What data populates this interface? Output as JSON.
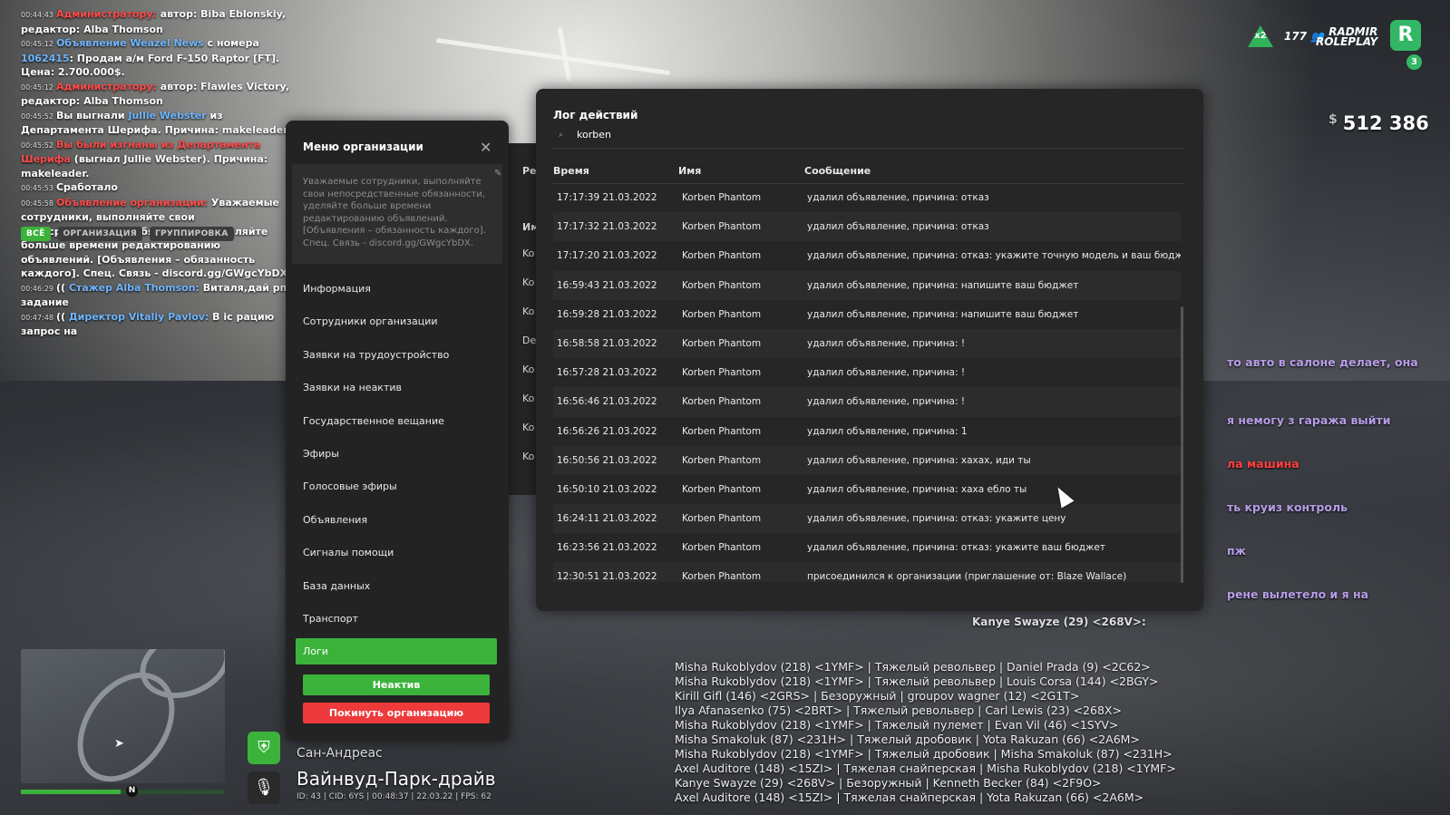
{
  "chat": {
    "lines": [
      {
        "ts": "00:44:43",
        "parts": [
          {
            "t": "Администратору: ",
            "c": "red"
          },
          {
            "t": "автор: Biba Eblonskiy, редактор: Alba Thomson",
            "c": ""
          }
        ]
      },
      {
        "ts": "00:45:12",
        "parts": [
          {
            "t": "Объявление Weazel News",
            "c": "blue"
          },
          {
            "t": " с номера ",
            "c": ""
          },
          {
            "t": "1062415",
            "c": "blue"
          },
          {
            "t": ": Продам а/м Ford F-150 Raptor [FT]. Цена: 2.700.000$.",
            "c": ""
          }
        ]
      },
      {
        "ts": "00:45:12",
        "parts": [
          {
            "t": "Администратору: ",
            "c": "red"
          },
          {
            "t": "автор: Flawles Victory, редактор: Alba Thomson",
            "c": ""
          }
        ]
      },
      {
        "ts": "00:45:52",
        "parts": [
          {
            "t": "Вы выгнали ",
            "c": ""
          },
          {
            "t": "Jullie Webster",
            "c": "blue"
          },
          {
            "t": " из Департамента Шерифа. Причина: makeleader.",
            "c": ""
          }
        ]
      },
      {
        "ts": "00:45:52",
        "parts": [
          {
            "t": "Вы были изгнаны из Департамента Шерифа",
            "c": "red"
          },
          {
            "t": " (выгнал Jullie Webster). Причина: makeleader.",
            "c": ""
          }
        ]
      },
      {
        "ts": "00:45:53",
        "parts": [
          {
            "t": "Сработало",
            "c": ""
          }
        ]
      },
      {
        "ts": "00:45:58",
        "parts": [
          {
            "t": "Объявление организации: ",
            "c": "red"
          },
          {
            "t": "Уважаемые сотрудники, выполняйте свои непосредственные обязанности, уделяйте больше времени редактированию объявлений. [Объявления – обязанность каждого]. Спец. Связь - discord.gg/GWgcYbDX.",
            "c": ""
          }
        ]
      },
      {
        "ts": "00:46:29",
        "parts": [
          {
            "t": "(( ",
            "c": ""
          },
          {
            "t": "Стажер Alba Thomson: ",
            "c": "blue"
          },
          {
            "t": "Виталя,дай рп задание",
            "c": ""
          }
        ]
      },
      {
        "ts": "00:47:48",
        "parts": [
          {
            "t": "(( ",
            "c": ""
          },
          {
            "t": "Директор Vitaliy Pavlov: ",
            "c": "blue"
          },
          {
            "t": "В ic рацию запрос на",
            "c": ""
          }
        ]
      }
    ],
    "tabs": [
      "ВСЁ",
      "ОРГАНИЗАЦИЯ",
      "ГРУППИРОВКА"
    ]
  },
  "org_menu": {
    "title": "Меню организации",
    "notice": "Уважаемые сотрудники, выполняйте свои непосредственные обязанности, уделяйте больше времени редактированию объявлений. [Объявления – обязанность каждого]. Спец. Связь - discord.gg/GWgcYbDX.",
    "items": [
      "Информация",
      "Сотрудники организации",
      "Заявки на трудоустройство",
      "Заявки на неактив",
      "Государственное вещание",
      "Эфиры",
      "Голосовые эфиры",
      "Объявления",
      "Сигналы помощи",
      "База данных",
      "Транспорт",
      "Логи"
    ],
    "inactive_btn": "Неактив",
    "leave_btn": "Покинуть организацию"
  },
  "back_panel": {
    "header": "Ре",
    "col": "Им",
    "rows": [
      "Ko",
      "Ko",
      "Ko",
      "De",
      "Ko",
      "Ko",
      "Ko",
      "Ko"
    ]
  },
  "log": {
    "title": "Лог действий",
    "search_value": "korben",
    "columns": [
      "Время",
      "Имя",
      "Сообщение"
    ],
    "rows": [
      [
        "17:17:39 21.03.2022",
        "Korben Phantom",
        "удалил объявление, причина: отказ"
      ],
      [
        "17:17:32 21.03.2022",
        "Korben Phantom",
        "удалил объявление, причина: отказ"
      ],
      [
        "17:17:20 21.03.2022",
        "Korben Phantom",
        "удалил объявление, причина: отказ: укажите точную модель и ваш бюджет"
      ],
      [
        "16:59:43 21.03.2022",
        "Korben Phantom",
        "удалил объявление, причина: напишите ваш бюджет"
      ],
      [
        "16:59:28 21.03.2022",
        "Korben Phantom",
        "удалил объявление, причина: напишите ваш бюджет"
      ],
      [
        "16:58:58 21.03.2022",
        "Korben Phantom",
        "удалил объявление, причина: !"
      ],
      [
        "16:57:28 21.03.2022",
        "Korben Phantom",
        "удалил объявление, причина: !"
      ],
      [
        "16:56:46 21.03.2022",
        "Korben Phantom",
        "удалил объявление, причина: !"
      ],
      [
        "16:56:26 21.03.2022",
        "Korben Phantom",
        "удалил объявление, причина: 1"
      ],
      [
        "16:50:56 21.03.2022",
        "Korben Phantom",
        "удалил объявление, причина: хахах, иди ты"
      ],
      [
        "16:50:10 21.03.2022",
        "Korben Phantom",
        "удалил объявление, причина: хаха ебло ты"
      ],
      [
        "16:24:11 21.03.2022",
        "Korben Phantom",
        "удалил объявление, причина: отказ: укажите цену"
      ],
      [
        "16:23:56 21.03.2022",
        "Korben Phantom",
        "удалил объявление, причина: отказ: укажите ваш бюджет"
      ],
      [
        "12:30:51 21.03.2022",
        "Korben Phantom",
        "присоединился к организации (приглашение от: Blaze Wallace)"
      ]
    ]
  },
  "hud": {
    "x2": "x2",
    "online": "177",
    "brand_line1": "RADMIR",
    "brand_line2": "ROLEPLAY",
    "server": "3",
    "money_sign": "$",
    "money": "512 386"
  },
  "right_chat": [
    {
      "t": "то авто в салоне делает, она",
      "c": "purple"
    },
    {
      "t": "я немогу з гаража выйти",
      "c": "purple"
    },
    {
      "t": "ла машина",
      "c": "red"
    },
    {
      "t": "ть круиз контроль",
      "c": "purple"
    },
    {
      "t": "пж",
      "c": "purple"
    },
    {
      "t": "рене вылетело и я на",
      "c": "purple"
    }
  ],
  "kanye_line": "Kanye Swayze (29) <268V>:",
  "killfeed": [
    "Misha Rukoblydov (218) <1YMF> | Тяжелый револьвер | Daniel Prada (9) <2C62>",
    "Misha Rukoblydov (218) <1YMF> | Тяжелый револьвер | Louis Corsa (144) <2BGY>",
    "Kirill Gifl (146) <2GRS> | Безоружный | groupov wagner (12) <2G1T>",
    "Ilya Afanasenko (75) <2BRT> | Тяжелый револьвер | Carl Lewis (23) <268X>",
    "Misha Rukoblydov (218) <1YMF> | Тяжелый пулемет | Evan Vil (46) <1SYV>",
    "Misha Smakoluk (87) <231H> | Тяжелый дробовик | Yota Rakuzan (66) <2A6M>",
    "Misha Rukoblydov (218) <1YMF> | Тяжелый дробовик | Misha Smakoluk (87) <231H>",
    "Axel Auditore (148) <15ZI> | Тяжелая снайперская | Misha Rukoblydov (218) <1YMF>",
    "Kanye Swayze (29) <268V> | Безоружный | Kenneth Becker (84) <2F9O>",
    "Axel Auditore (148) <15ZI> | Тяжелая снайперская | Yota Rakuzan (66) <2A6M>"
  ],
  "location": {
    "region": "Сан-Андреас",
    "street": "Вайнвуд-Парк-драйв",
    "meta": "ID: 43 | CID: 6YS | 00:48:37 | 22.03.22 | FPS: 62",
    "compass": "N"
  },
  "colors": {
    "accent": "#3bb33b",
    "danger": "#ee3a3a",
    "panel": "#262626"
  }
}
